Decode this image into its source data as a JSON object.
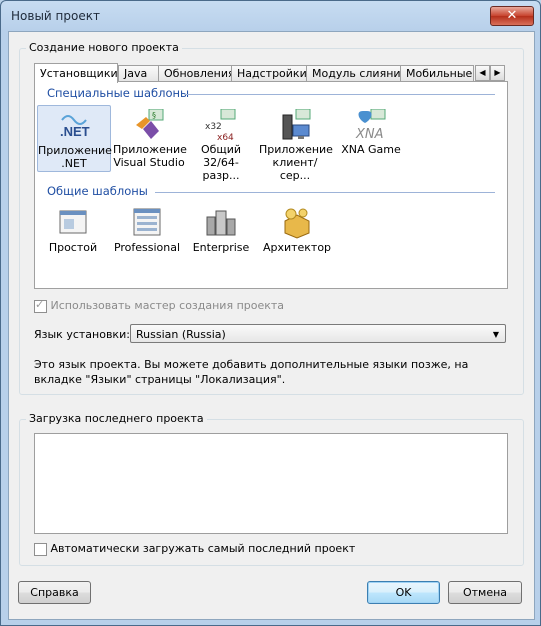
{
  "window": {
    "title": "Новый проект",
    "close_symbol": "✕"
  },
  "new_project": {
    "group_label": "Создание нового проекта",
    "tabs": [
      "Установщики",
      "Java",
      "Обновления",
      "Надстройки",
      "Модуль слияния",
      "Мобильные п"
    ],
    "tab_scroll_left": "◀",
    "tab_scroll_right": "▶",
    "special_title": "Специальные шаблоны",
    "special_templates": [
      {
        "label": "Приложение .NET",
        "icon": "dotnet-icon",
        "icon_text": ".NET"
      },
      {
        "label": "Приложение Visual Studio",
        "icon": "visual-studio-icon"
      },
      {
        "label": "Общий 32/64-разр...",
        "icon": "x32-x64-icon",
        "icon_text_top": "x32",
        "icon_text_bottom": "x64"
      },
      {
        "label": "Приложение клиент/сер...",
        "icon": "client-server-icon"
      },
      {
        "label": "XNA Game",
        "icon": "xna-icon",
        "icon_text": "XNA"
      }
    ],
    "general_title": "Общие шаблоны",
    "general_templates": [
      {
        "label": "Простой",
        "icon": "simple-icon"
      },
      {
        "label": "Professional",
        "icon": "professional-icon"
      },
      {
        "label": "Enterprise",
        "icon": "enterprise-icon"
      },
      {
        "label": "Архитектор",
        "icon": "architect-icon"
      }
    ],
    "wizard_checkbox_label": "Использовать мастер создания проекта",
    "wizard_checked": true,
    "language_label": "Язык установки:",
    "language_value": "Russian (Russia)",
    "language_note": "Это язык проекта. Вы можете добавить дополнительные языки позже, на вкладке \"Языки\" страницы \"Локализация\"."
  },
  "load_last": {
    "group_label": "Загрузка последнего проекта",
    "auto_load_label": "Автоматически загружать самый последний проект",
    "auto_load_checked": false
  },
  "buttons": {
    "help": "Справка",
    "ok": "OK",
    "cancel": "Отмена"
  },
  "colors": {
    "section_title": "#1f4ea3",
    "selected_bg": "#dfe9f7",
    "title_bar": "#bcd3ea"
  }
}
